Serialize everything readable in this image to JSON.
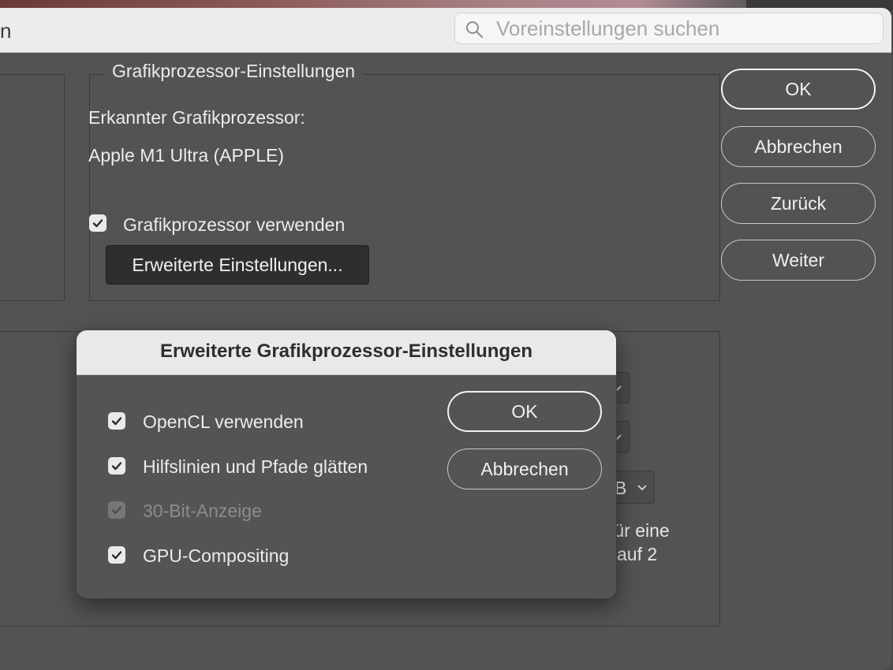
{
  "window": {
    "title_fragment": "n"
  },
  "search": {
    "placeholder": "Voreinstellungen suchen"
  },
  "gpu_settings": {
    "legend": "Grafikprozessor-Einstellungen",
    "detected_label": "Erkannter Grafikprozessor:",
    "detected_value": "Apple M1 Ultra (APPLE)",
    "use_gpu_label": "Grafikprozessor verwenden",
    "use_gpu_checked": true,
    "advanced_button": "Erweiterte Einstellungen..."
  },
  "side_buttons": {
    "ok": "OK",
    "cancel": "Abbrechen",
    "back": "Zurück",
    "next": "Weiter"
  },
  "background_fragments": {
    "dropdown_text": "B",
    "text_line1": "für eine",
    "text_line2": "auf 2"
  },
  "modal": {
    "title": "Erweiterte Grafikprozessor-Einstellungen",
    "options": [
      {
        "label": "OpenCL verwenden",
        "checked": true,
        "enabled": true
      },
      {
        "label": "Hilfslinien und Pfade glätten",
        "checked": true,
        "enabled": true
      },
      {
        "label": "30-Bit-Anzeige",
        "checked": true,
        "enabled": false
      },
      {
        "label": "GPU-Compositing",
        "checked": true,
        "enabled": true
      }
    ],
    "ok": "OK",
    "cancel": "Abbrechen"
  },
  "colors": {
    "panel_bg": "#535353",
    "titlebar_bg": "#ececec",
    "checkbox_fill": "#eaeaea",
    "dark_button": "#2e2e2e"
  }
}
